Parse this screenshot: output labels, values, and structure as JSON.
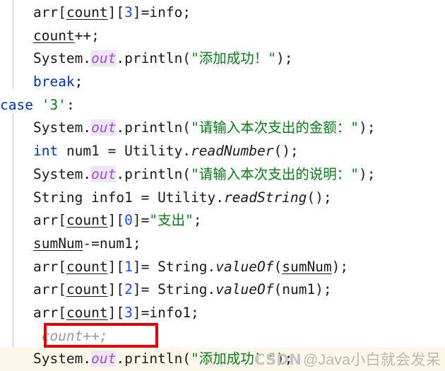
{
  "editor": {
    "language": "Java",
    "background_color": "#ffffff",
    "current_line_highlight_color": "#fbf8e9",
    "indent_guide_color": "#c8c8c8",
    "annotation_box_color": "#e60000",
    "ghost_text_color": "#9b9b9b",
    "colors": {
      "keyword": "#0033b3",
      "number": "#1750eb",
      "string": "#067d17",
      "char": "#067d17",
      "static_field_highlight": "#9b4fd6",
      "plain_text": "#1a1a1a"
    }
  },
  "code_lines": [
    {
      "id": "line-1",
      "indent": 1,
      "text": "arr[count][3]=info;",
      "tokens": [
        {
          "t": "arr[",
          "k": "plain"
        },
        {
          "t": "count",
          "k": "field"
        },
        {
          "t": "][",
          "k": "plain"
        },
        {
          "t": "3",
          "k": "num"
        },
        {
          "t": "]=info;",
          "k": "plain"
        }
      ]
    },
    {
      "id": "line-2",
      "indent": 1,
      "text": "count++;",
      "tokens": [
        {
          "t": "count",
          "k": "field"
        },
        {
          "t": "++;",
          "k": "plain"
        }
      ]
    },
    {
      "id": "line-3",
      "indent": 1,
      "text": "System.out.println(\"添加成功！\");",
      "tokens": [
        {
          "t": "System.",
          "k": "plain"
        },
        {
          "t": "out",
          "k": "out"
        },
        {
          "t": ".println(",
          "k": "plain"
        },
        {
          "t": "\"添加成功！\"",
          "k": "str"
        },
        {
          "t": ");",
          "k": "plain"
        }
      ]
    },
    {
      "id": "line-4",
      "indent": 1,
      "text": "break;",
      "tokens": [
        {
          "t": "break",
          "k": "kw"
        },
        {
          "t": ";",
          "k": "plain"
        }
      ]
    },
    {
      "id": "line-5",
      "indent": 0,
      "text": "case '3':",
      "tokens": [
        {
          "t": "case ",
          "k": "kw"
        },
        {
          "t": "'3'",
          "k": "chr"
        },
        {
          "t": ":",
          "k": "plain"
        }
      ]
    },
    {
      "id": "line-6",
      "indent": 1,
      "text": "System.out.println(\"请输入本次支出的金额：\");",
      "tokens": [
        {
          "t": "System.",
          "k": "plain"
        },
        {
          "t": "out",
          "k": "out"
        },
        {
          "t": ".println(",
          "k": "plain"
        },
        {
          "t": "\"请输入本次支出的金额：\"",
          "k": "str"
        },
        {
          "t": ");",
          "k": "plain"
        }
      ]
    },
    {
      "id": "line-7",
      "indent": 1,
      "text": "int num1 = Utility.readNumber();",
      "tokens": [
        {
          "t": "int",
          "k": "kw"
        },
        {
          "t": " num1 = Utility.",
          "k": "plain"
        },
        {
          "t": "readNumber",
          "k": "stat"
        },
        {
          "t": "();",
          "k": "plain"
        }
      ]
    },
    {
      "id": "line-8",
      "indent": 1,
      "text": "System.out.println(\"请输入本次支出的说明：\");",
      "tokens": [
        {
          "t": "System.",
          "k": "plain"
        },
        {
          "t": "out",
          "k": "out"
        },
        {
          "t": ".println(",
          "k": "plain"
        },
        {
          "t": "\"请输入本次支出的说明：\"",
          "k": "str"
        },
        {
          "t": ");",
          "k": "plain"
        }
      ]
    },
    {
      "id": "line-9",
      "indent": 1,
      "text": "String info1 = Utility.readString();",
      "tokens": [
        {
          "t": "String info1 = Utility.",
          "k": "plain"
        },
        {
          "t": "readString",
          "k": "stat"
        },
        {
          "t": "();",
          "k": "plain"
        }
      ]
    },
    {
      "id": "line-10",
      "indent": 1,
      "text": "arr[count][0]=\"支出\";",
      "tokens": [
        {
          "t": "arr[",
          "k": "plain"
        },
        {
          "t": "count",
          "k": "field"
        },
        {
          "t": "][",
          "k": "plain"
        },
        {
          "t": "0",
          "k": "num"
        },
        {
          "t": "]=",
          "k": "plain"
        },
        {
          "t": "\"支出\"",
          "k": "str"
        },
        {
          "t": ";",
          "k": "plain"
        }
      ]
    },
    {
      "id": "line-11",
      "indent": 1,
      "text": "sumNum-=num1;",
      "tokens": [
        {
          "t": "sumNum",
          "k": "field"
        },
        {
          "t": "-=num1;",
          "k": "plain"
        }
      ]
    },
    {
      "id": "line-12",
      "indent": 1,
      "text": "arr[count][1]= String.valueOf(sumNum);",
      "tokens": [
        {
          "t": "arr[",
          "k": "plain"
        },
        {
          "t": "count",
          "k": "field"
        },
        {
          "t": "][",
          "k": "plain"
        },
        {
          "t": "1",
          "k": "num"
        },
        {
          "t": "]= String.",
          "k": "plain"
        },
        {
          "t": "valueOf",
          "k": "stat"
        },
        {
          "t": "(",
          "k": "plain"
        },
        {
          "t": "sumNum",
          "k": "field"
        },
        {
          "t": ");",
          "k": "plain"
        }
      ]
    },
    {
      "id": "line-13",
      "indent": 1,
      "text": "arr[count][2]= String.valueOf(num1);",
      "tokens": [
        {
          "t": "arr[",
          "k": "plain"
        },
        {
          "t": "count",
          "k": "field"
        },
        {
          "t": "][",
          "k": "plain"
        },
        {
          "t": "2",
          "k": "num"
        },
        {
          "t": "]= String.",
          "k": "plain"
        },
        {
          "t": "valueOf",
          "k": "stat"
        },
        {
          "t": "(num1);",
          "k": "plain"
        }
      ]
    },
    {
      "id": "line-14",
      "indent": 1,
      "text": "arr[count][3]=info1;",
      "tokens": [
        {
          "t": "arr[",
          "k": "plain"
        },
        {
          "t": "count",
          "k": "field"
        },
        {
          "t": "][",
          "k": "plain"
        },
        {
          "t": "3",
          "k": "num"
        },
        {
          "t": "]=info1;",
          "k": "plain"
        }
      ]
    },
    {
      "id": "line-15",
      "indent": 1,
      "text": "count++;",
      "ghost": true,
      "tokens": [
        {
          "t": " count++;",
          "k": "ghost"
        }
      ]
    },
    {
      "id": "line-16",
      "indent": 1,
      "current": true,
      "text": "System.out.println(\"添加成功！\");",
      "tokens": [
        {
          "t": "System.",
          "k": "plain"
        },
        {
          "t": "out",
          "k": "out"
        },
        {
          "t": ".println(",
          "k": "plain"
        },
        {
          "t": "\"添加成功！\"",
          "k": "str"
        },
        {
          "t": ");",
          "k": "plain"
        }
      ]
    }
  ],
  "annotation": {
    "label": "red-highlight-box",
    "target_line_id": "line-15",
    "target_text": "count++;"
  },
  "watermark": {
    "brand": "CSDN",
    "author": "@Java小白就会发呆"
  }
}
